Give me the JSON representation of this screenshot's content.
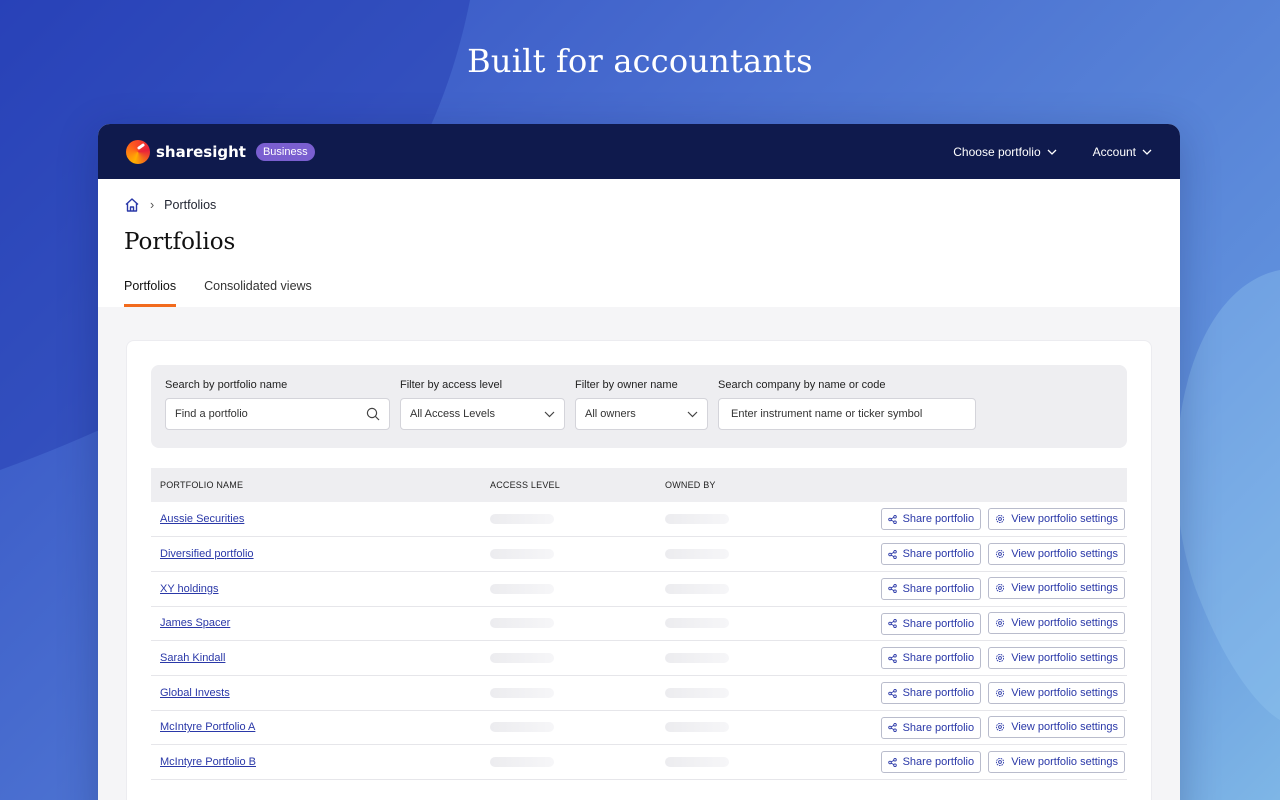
{
  "hero": {
    "title": "Built for accountants"
  },
  "topnav": {
    "brand": "sharesight",
    "badge": "Business",
    "choose_portfolio": "Choose portfolio",
    "account": "Account"
  },
  "breadcrumb": {
    "current": "Portfolios"
  },
  "page": {
    "title": "Portfolios"
  },
  "tabs": [
    {
      "label": "Portfolios",
      "active": true
    },
    {
      "label": "Consolidated views",
      "active": false
    }
  ],
  "filters": {
    "search_name": {
      "label": "Search by portfolio name",
      "placeholder": "Find a portfolio"
    },
    "access_level": {
      "label": "Filter by access level",
      "value": "All Access Levels"
    },
    "owner": {
      "label": "Filter by owner name",
      "value": "All owners"
    },
    "company": {
      "label": "Search company by name or code",
      "placeholder": "Enter instrument name or ticker symbol"
    }
  },
  "table": {
    "headers": {
      "name": "PORTFOLIO NAME",
      "access": "ACCESS LEVEL",
      "owner": "OWNED BY"
    },
    "share_label": "Share portfolio",
    "settings_label": "View portfolio settings",
    "rows": [
      {
        "name": "Aussie Securities"
      },
      {
        "name": "Diversified portfolio"
      },
      {
        "name": "XY holdings"
      },
      {
        "name": "James Spacer"
      },
      {
        "name": "Sarah Kindall"
      },
      {
        "name": "Global Invests"
      },
      {
        "name": "McIntyre Portfolio A"
      },
      {
        "name": "McIntyre Portfolio B"
      }
    ]
  },
  "colors": {
    "nav_bg": "#0f1a4d",
    "accent_tab": "#f26b1d",
    "link": "#2a38a8",
    "badge": "#7a5fd0"
  }
}
